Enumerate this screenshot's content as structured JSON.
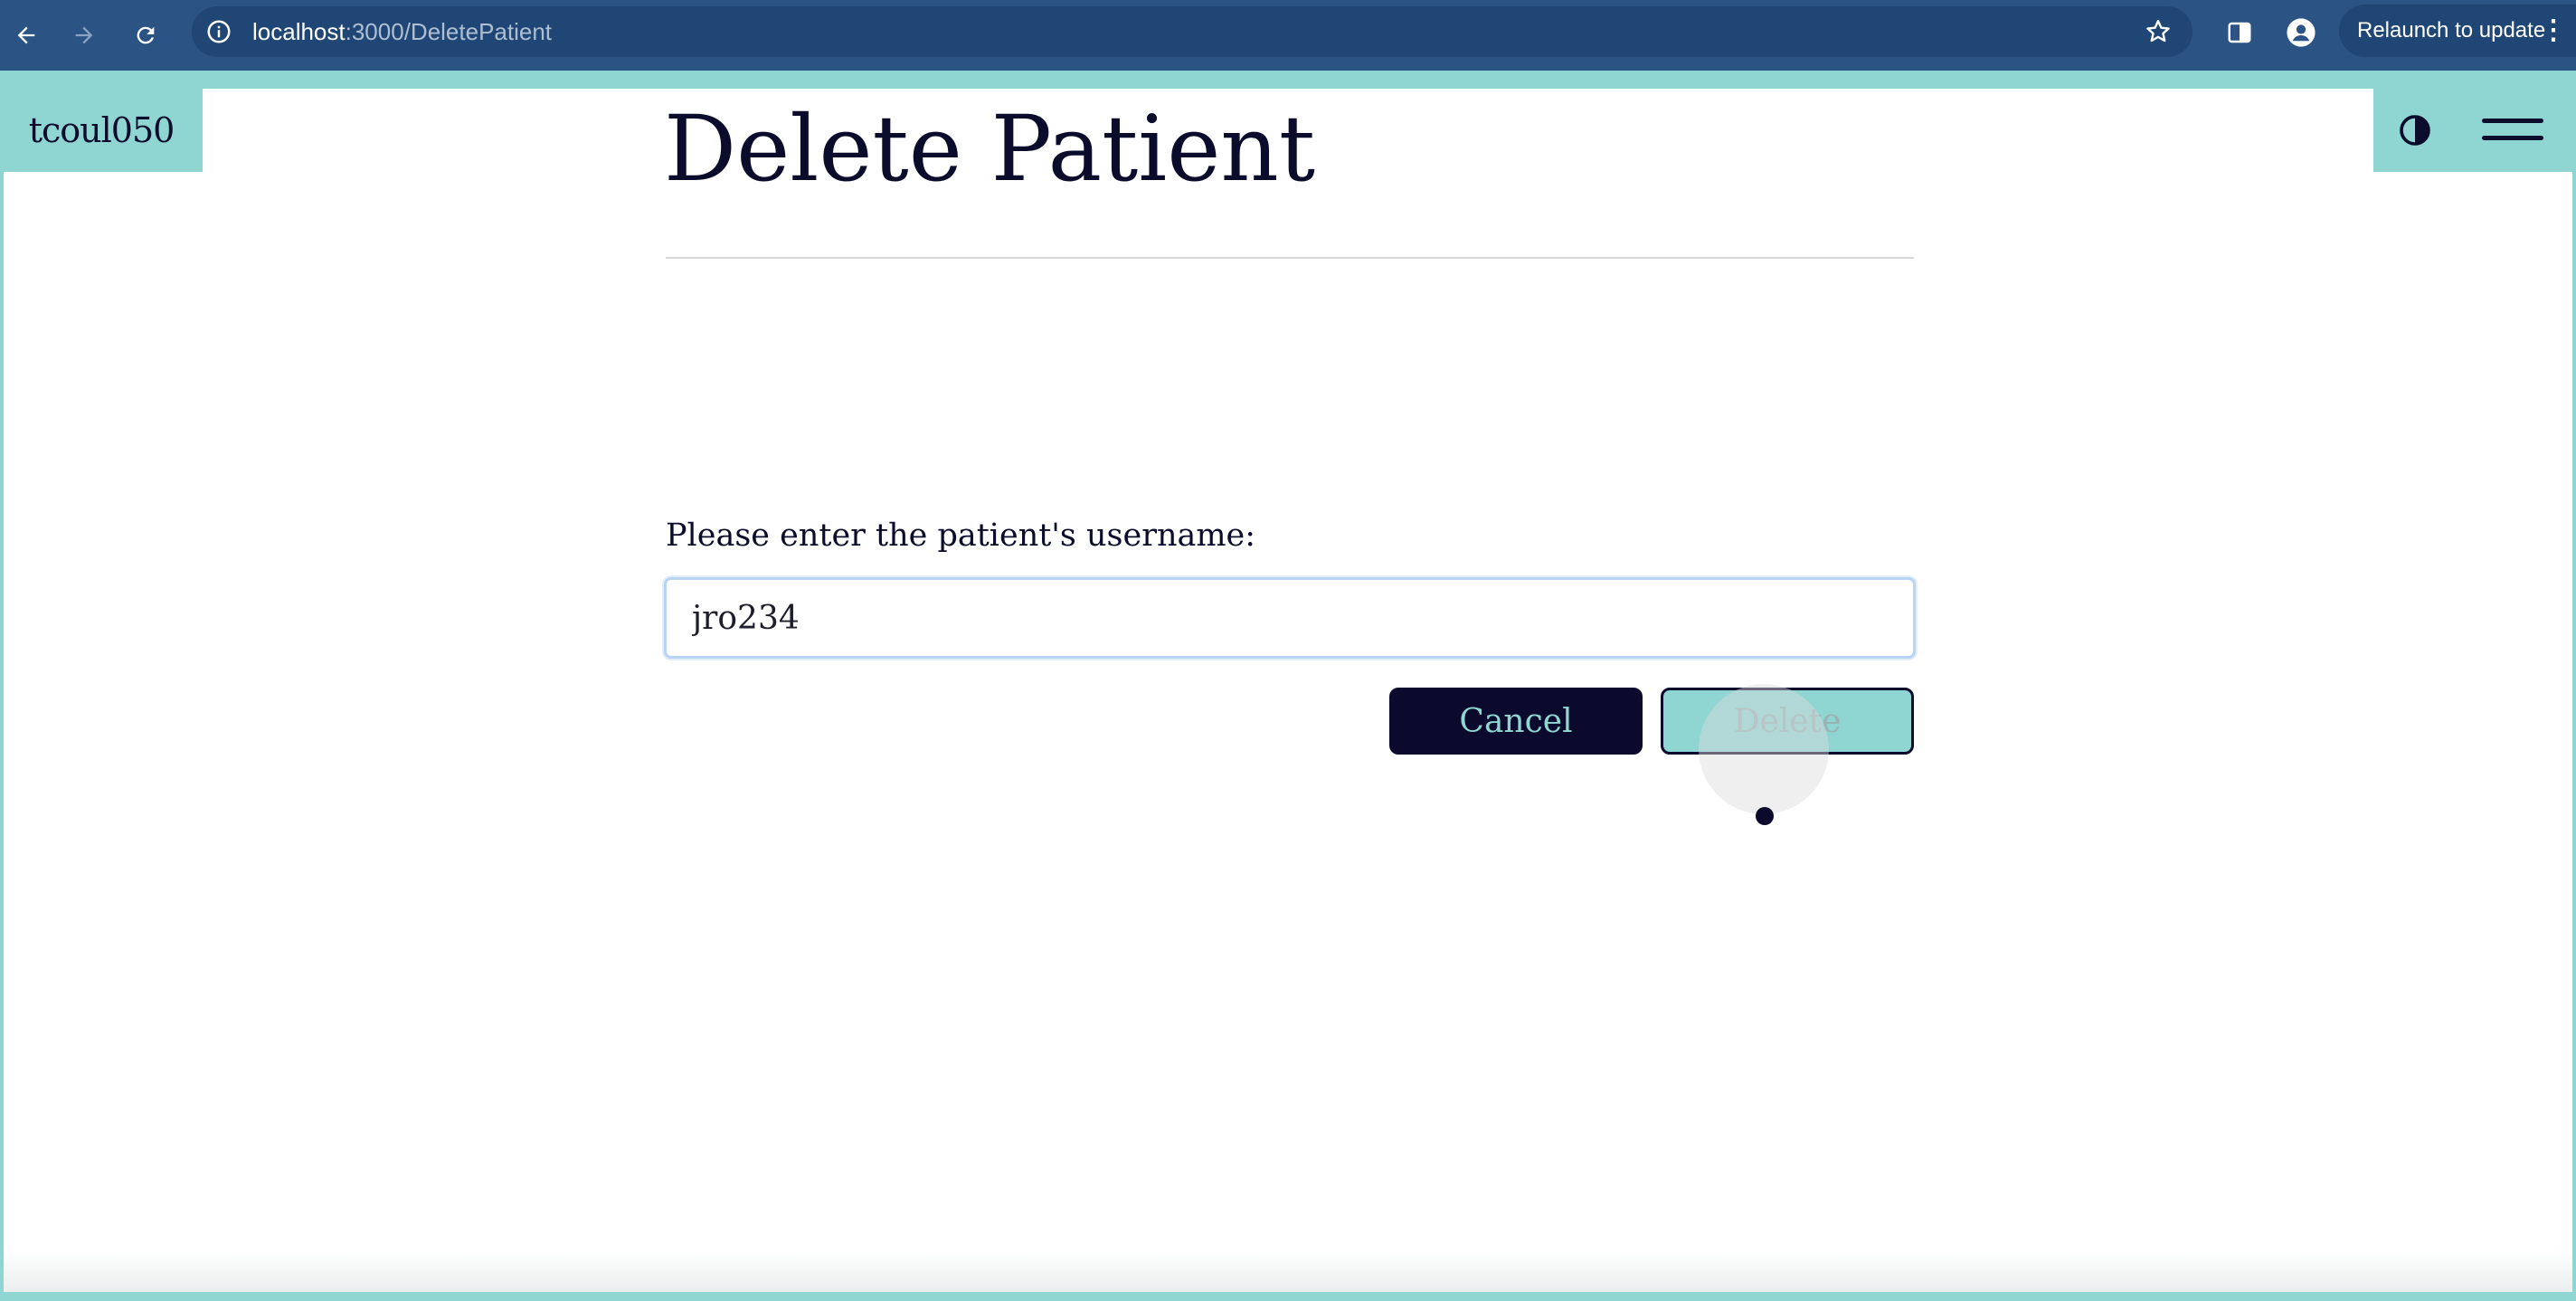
{
  "browser": {
    "url_host": "localhost",
    "url_path": ":3000/DeletePatient",
    "relaunch_label": "Relaunch to update",
    "menu_glyph": "⋮",
    "icons": {
      "back": "arrow-left-icon",
      "forward": "arrow-right-icon",
      "reload": "reload-icon",
      "site_info": "info-icon",
      "bookmark": "star-icon",
      "side_panel": "side-panel-icon",
      "profile": "profile-icon"
    },
    "colors": {
      "toolbar": "#2b5383",
      "omnibox": "#1f4674"
    }
  },
  "header": {
    "brand": "tcoul050",
    "icons": {
      "theme": "contrast-icon",
      "menu": "hamburger-menu-icon"
    }
  },
  "main": {
    "title": "Delete Patient",
    "field_label": "Please enter the patient's username:",
    "username_value": "jro234",
    "cancel_label": "Cancel",
    "delete_label": "Delete"
  },
  "colors": {
    "accent": "#8fd6d2",
    "navy": "#0b0a2c",
    "text": "#0b0c2c"
  }
}
